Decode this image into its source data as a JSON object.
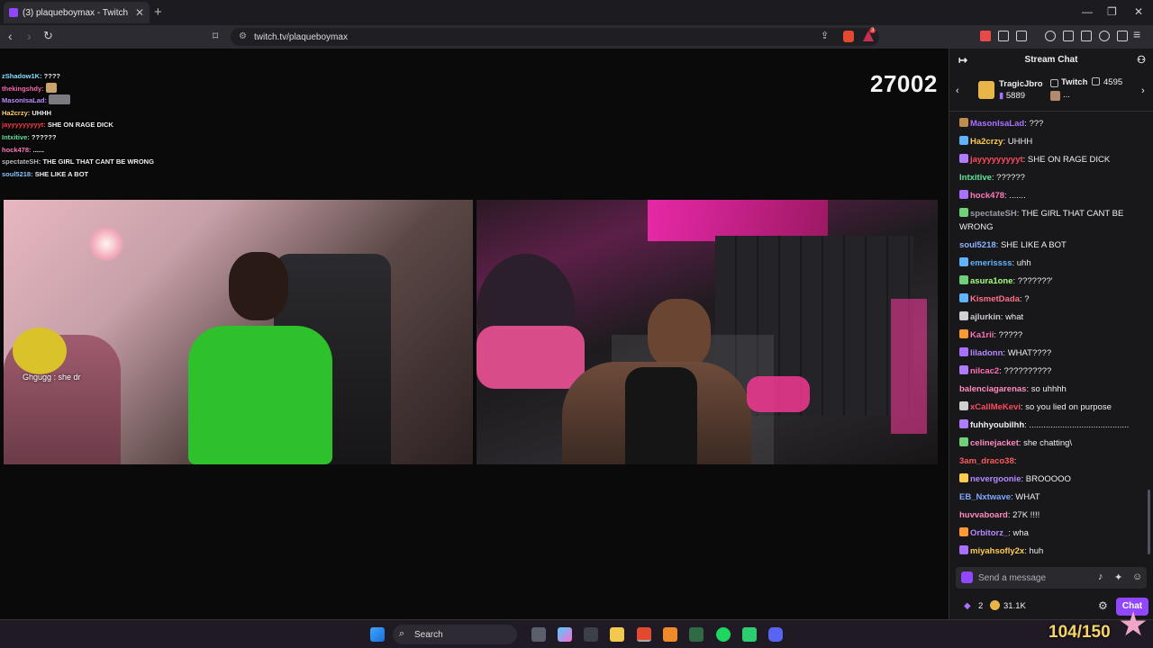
{
  "browser": {
    "tab_title": "(3) plaqueboymax - Twitch",
    "tab_close": "✕",
    "new_tab": "+",
    "url": "twitch.tv/plaqueboymax",
    "notify_badge": "3"
  },
  "stream": {
    "viewer_count": "27002",
    "overlay_chat": [
      {
        "user": "zShadow1K:",
        "text": " ????",
        "color": "#7fe0ff"
      },
      {
        "user": "thekingshdy:",
        "text": "",
        "color": "#ff66b3"
      },
      {
        "user": "MasonIsaLad:",
        "text": "",
        "color": "#c08cff"
      },
      {
        "user": "Ha2crzy:",
        "text": " UHHH",
        "color": "#ffd06b"
      },
      {
        "user": "jayyyyyyyyyt:",
        "text": " SHE ON RAGE DICK",
        "color": "#ff3a4a"
      },
      {
        "user": "Intxitive:",
        "text": " ??????",
        "color": "#5ee39b"
      },
      {
        "user": "hock478:",
        "text": " ......",
        "color": "#ff7ab8"
      },
      {
        "user": "spectateSH:",
        "text": " THE GIRL THAT CANT BE WRONG",
        "color": "#b9b9c0"
      },
      {
        "user": "soul5218:",
        "text": " SHE LIKE A BOT",
        "color": "#89c6ff"
      }
    ],
    "cam_caption": "Ghgugg : she dr"
  },
  "chat": {
    "header": "Stream Chat",
    "gift_left_user": "TragicJbro",
    "gift_left_count": "5889",
    "gift_right_user": "Twitch",
    "gift_right_count": "4595",
    "gift_right_sub": "...",
    "messages": [
      {
        "user": "MasonIsaLad",
        "text": ": ???",
        "color": "#a970ff",
        "badge": "#c08c4a"
      },
      {
        "user": "Ha2crzy",
        "text": ": UHHH",
        "color": "#ffcc4d",
        "badge": "#5fb3ff"
      },
      {
        "user": "jayyyyyyyyyt",
        "text": ": SHE ON RAGE DICK",
        "color": "#ff4a5e",
        "badge": "#b07cff"
      },
      {
        "user": "Intxitive",
        "text": ": ??????",
        "color": "#5ee39b",
        "badge": ""
      },
      {
        "user": "hock478",
        "text": ": .......",
        "color": "#ff7ab8",
        "badge": "#a970ff"
      },
      {
        "user": "spectateSH",
        "text": ": THE GIRL THAT CANT BE WRONG",
        "color": "#9b9ba6",
        "badge": "#6ed178"
      },
      {
        "user": "soul5218",
        "text": ": SHE LIKE A BOT",
        "color": "#8ab4ff",
        "badge": ""
      },
      {
        "user": "emerissss",
        "text": ": uhh",
        "color": "#5fb3ff",
        "badge": "#5fb3ff"
      },
      {
        "user": "asura1one",
        "text": ": ???????'",
        "color": "#a3ff77",
        "badge": "#6ed178"
      },
      {
        "user": "KismetDada",
        "text": ": ?",
        "color": "#ff6f8a",
        "badge": "#5fb3ff"
      },
      {
        "user": "ajlurkin",
        "text": ": what",
        "color": "#c8c8d0",
        "badge": "#d0d0d0"
      },
      {
        "user": "Ka1rii",
        "text": ": ?????",
        "color": "#ff6fb5",
        "badge": "#ff9933"
      },
      {
        "user": "liladonn",
        "text": ": WHAT????",
        "color": "#b58aff",
        "badge": "#a970ff"
      },
      {
        "user": "nilcac2",
        "text": ": ??????????",
        "color": "#ff6fb5",
        "badge": "#b07cff"
      },
      {
        "user": "balenciagarenas",
        "text": ": so uhhhh",
        "color": "#ff89c0",
        "badge": ""
      },
      {
        "user": "xCallMeKevi",
        "text": ": so you lied on purpose",
        "color": "#ff4a5e",
        "badge": "#d0d0d0"
      },
      {
        "user": "fuhhyoubilhh",
        "text": ": ..........................................",
        "color": "#efeff1",
        "badge": "#b07cff"
      },
      {
        "user": "celinejacket",
        "text": ": she chatting\\",
        "color": "#ff89c0",
        "badge": "#6ed178"
      },
      {
        "user": "3am_draco38",
        "text": ":",
        "color": "#ff5a5a",
        "badge": ""
      },
      {
        "user": "nevergoonie",
        "text": ": BROOOOO",
        "color": "#b58aff",
        "badge": "#ffcc4d"
      },
      {
        "user": "EB_Nxtwave",
        "text": ": WHAT",
        "color": "#7fa8ff",
        "badge": ""
      },
      {
        "user": "huvvaboard",
        "text": ": 27K !!!!",
        "color": "#ff89c0",
        "badge": ""
      },
      {
        "user": "Orbitorz_",
        "text": ": wha",
        "color": "#b58aff",
        "badge": "#ff9933"
      },
      {
        "user": "miyahsofly2x",
        "text": ": huh",
        "color": "#ffcc4d",
        "badge": "#a970ff"
      }
    ],
    "composer_placeholder": "Send a message",
    "bits_count": "2",
    "points": "31.1K",
    "chat_button": "Chat"
  },
  "taskbar": {
    "search_label": "Search",
    "hud_count": "104/150"
  }
}
